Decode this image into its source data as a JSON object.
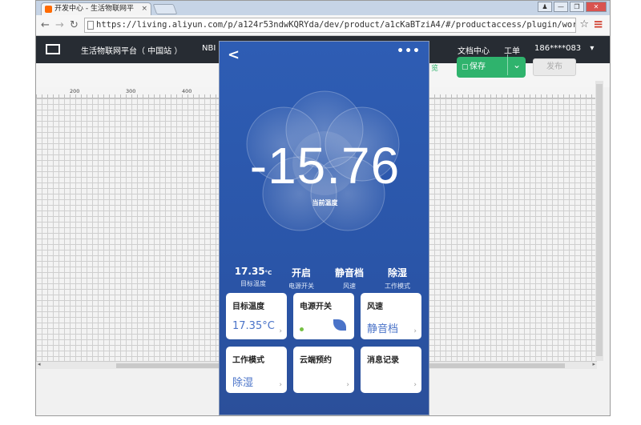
{
  "browser": {
    "tab_title": "开发中心 - 生活物联网平",
    "tab_close": "×",
    "url": "https://living.aliyun.com/p/a124r53ndwKQRYda/dev/product/a1cKaBTziA4/#/productaccess/plugin/workbench/edit",
    "win_buttons": [
      "♟",
      "—",
      "❐",
      "✕"
    ]
  },
  "header": {
    "platform": "生活物联网平台（ 中国站 ）",
    "nbiot": "NBI",
    "docs": "文档中心",
    "ticket": "工单",
    "account": "186****083",
    "account_caret": "▾"
  },
  "toolbar": {
    "save_label": "保存",
    "save_caret": "⌄",
    "publish_label": "发布",
    "preview_fragment": "览"
  },
  "ruler_ticks": [
    "200",
    "300",
    "400"
  ],
  "phone": {
    "back": "<",
    "more": "•••",
    "temperature": "-15.76",
    "temperature_label": "当前温度",
    "stats": [
      {
        "value": "17.35",
        "unit": "°C",
        "label": "目标温度"
      },
      {
        "value": "开启",
        "unit": "",
        "label": "电源开关"
      },
      {
        "value": "静音档",
        "unit": "",
        "label": "风速"
      },
      {
        "value": "除湿",
        "unit": "",
        "label": "工作模式"
      }
    ],
    "cards": [
      {
        "title": "目标温度",
        "value": "17.35°C"
      },
      {
        "title": "电源开关",
        "value": ""
      },
      {
        "title": "风速",
        "value": "静音档"
      },
      {
        "title": "工作模式",
        "value": "除湿"
      },
      {
        "title": "云端预约",
        "value": ""
      },
      {
        "title": "消息记录",
        "value": ""
      }
    ],
    "chevron": "›"
  },
  "colors": {
    "phone_bg": "#2e5db4",
    "header_bg": "#272c33",
    "save_green": "#2fb36d",
    "card_value_blue": "#4a73c8",
    "status_dot_green": "#76c043"
  }
}
